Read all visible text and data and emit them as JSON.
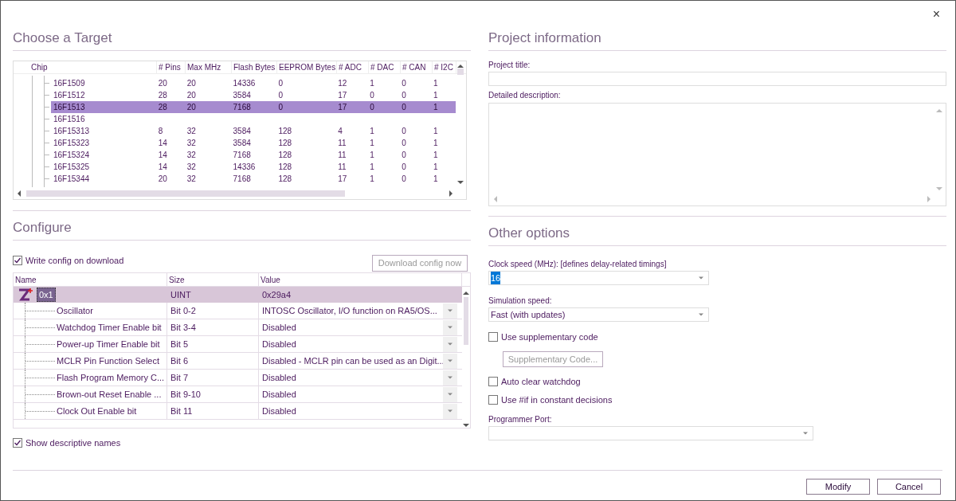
{
  "window": {
    "close": "×"
  },
  "target": {
    "heading": "Choose a Target",
    "columns": [
      "Chip",
      "# Pins",
      "Max MHz",
      "Flash Bytes",
      "EEPROM Bytes",
      "# ADC",
      "# DAC",
      "# CAN",
      "# I2C"
    ],
    "rows": [
      {
        "cells": [
          "16F1509",
          "20",
          "20",
          "14336",
          "0",
          "12",
          "1",
          "0",
          "1"
        ],
        "selected": false
      },
      {
        "cells": [
          "16F1512",
          "28",
          "20",
          "3584",
          "0",
          "17",
          "0",
          "0",
          "1"
        ],
        "selected": false
      },
      {
        "cells": [
          "16F1513",
          "28",
          "20",
          "7168",
          "0",
          "17",
          "0",
          "0",
          "1"
        ],
        "selected": true
      },
      {
        "cells": [
          "16F1516"
        ],
        "selected": false
      },
      {
        "cells": [
          "16F15313",
          "8",
          "32",
          "3584",
          "128",
          "4",
          "1",
          "0",
          "1"
        ],
        "selected": false
      },
      {
        "cells": [
          "16F15323",
          "14",
          "32",
          "3584",
          "128",
          "11",
          "1",
          "0",
          "1"
        ],
        "selected": false
      },
      {
        "cells": [
          "16F15324",
          "14",
          "32",
          "7168",
          "128",
          "11",
          "1",
          "0",
          "1"
        ],
        "selected": false
      },
      {
        "cells": [
          "16F15325",
          "14",
          "32",
          "14336",
          "128",
          "11",
          "1",
          "0",
          "1"
        ],
        "selected": false
      },
      {
        "cells": [
          "16F15344",
          "20",
          "32",
          "7168",
          "128",
          "17",
          "1",
          "0",
          "1"
        ],
        "selected": false
      }
    ]
  },
  "configure": {
    "heading": "Configure",
    "write_config": {
      "label": "Write config on download",
      "checked": true
    },
    "download_button": {
      "label": "Download config now",
      "disabled": true
    },
    "columns": [
      "Name",
      "Size",
      "Value"
    ],
    "root": {
      "name": "0x1",
      "size": "UINT",
      "value": "0x29a4",
      "selected": true
    },
    "rows": [
      {
        "name": "Oscillator",
        "size": "Bit 0-2",
        "value": "INTOSC Oscillator, I/O function on RA5/OS..."
      },
      {
        "name": "Watchdog Timer Enable bit",
        "size": "Bit 3-4",
        "value": "Disabled"
      },
      {
        "name": "Power-up Timer Enable bit",
        "size": "Bit 5",
        "value": "Disabled"
      },
      {
        "name": "MCLR Pin Function Select",
        "size": "Bit 6",
        "value": "Disabled - MCLR pin can be used as an Digit..."
      },
      {
        "name": "Flash Program Memory C...",
        "size": "Bit 7",
        "value": "Disabled"
      },
      {
        "name": "Brown-out Reset Enable ...",
        "size": "Bit 9-10",
        "value": "Disabled"
      },
      {
        "name": "Clock Out Enable bit",
        "size": "Bit 11",
        "value": "Disabled"
      }
    ],
    "show_descriptive": {
      "label": "Show descriptive names",
      "checked": true
    }
  },
  "project": {
    "heading": "Project information",
    "title_label": "Project title:",
    "description_label": "Detailed description:"
  },
  "options": {
    "heading": "Other options",
    "clock_label": "Clock speed (MHz): [defines delay-related timings]",
    "clock_value": "16",
    "clock_text_selected": true,
    "sim_label": "Simulation speed:",
    "sim_value": "Fast (with updates)",
    "use_supp": {
      "label": "Use supplementary code",
      "checked": false
    },
    "supp_button": {
      "label": "Supplementary Code...",
      "disabled": true
    },
    "auto_clear": {
      "label": "Auto clear watchdog",
      "checked": false
    },
    "use_if": {
      "label": "Use #if in constant decisions",
      "checked": false
    },
    "port_label": "Programmer Port:"
  },
  "buttons": [
    "Modify",
    "Cancel"
  ]
}
